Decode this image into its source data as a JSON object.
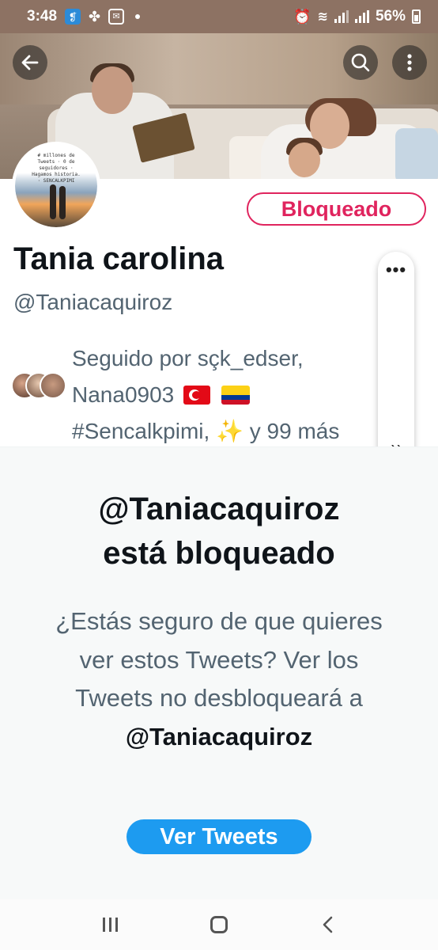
{
  "status_bar": {
    "time": "3:48",
    "battery": "56%"
  },
  "profile": {
    "display_name": "Tania carolina",
    "handle": "@Taniacaquiroz",
    "blocked_badge": "Bloqueado",
    "followed_by": {
      "line1": "Seguido por sçk_edser,",
      "line2": "Nana0903",
      "line3_tag": "#Sencalkpimi,",
      "line3_rest": "y 99 más"
    },
    "avatar_text": "# millones de Tweets · 0 de seguidores · Hagamos historia. · SENCALKPIMI"
  },
  "banner": {
    "back_icon": "arrow-left-icon",
    "search_icon": "search-icon",
    "more_icon": "more-vertical-icon"
  },
  "blocked_notice": {
    "title_line1": "@Taniacaquiroz",
    "title_line2": "está bloqueado",
    "desc": "¿Estás seguro de que quieres ver estos Tweets? Ver los Tweets no desbloqueará a",
    "desc_handle": "@Taniacaquiroz",
    "button_label": "Ver Tweets"
  },
  "side_panel": {
    "dots": "•••",
    "audio": "♪))"
  },
  "colors": {
    "accent": "#1d9bf0",
    "blocked": "#e0245e",
    "secondary_text": "#536471"
  }
}
